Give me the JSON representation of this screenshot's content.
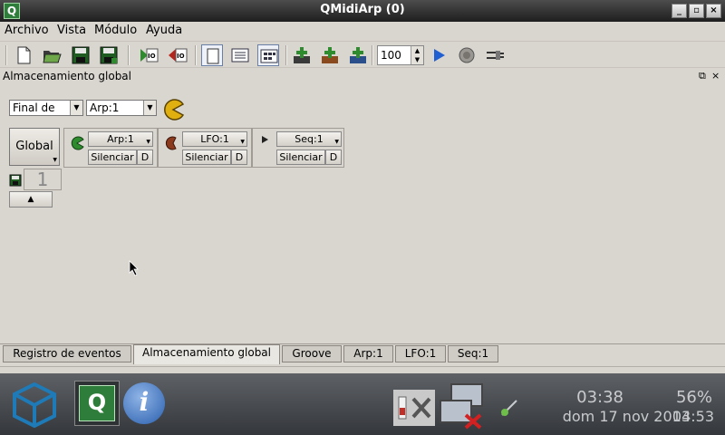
{
  "window": {
    "title": "QMidiArp (0)",
    "app_icon_letter": "Q",
    "minimize_glyph": "_",
    "maximize_glyph": "▫",
    "close_glyph": "×"
  },
  "menu": {
    "items": [
      {
        "label": "Archivo"
      },
      {
        "label": "Vista"
      },
      {
        "label": "Módulo"
      },
      {
        "label": "Ayuda"
      }
    ]
  },
  "toolbar": {
    "tempo_value": "100",
    "icons": [
      "new-file-icon",
      "open-file-icon",
      "save-icon",
      "save-as-icon",
      "midi-in-icon",
      "midi-out-icon",
      "view-page-icon",
      "view-list-icon",
      "view-grid-icon",
      "add-arp-icon",
      "add-lfo-icon",
      "add-seq-icon",
      "play-icon",
      "midi-clock-icon",
      "jack-sync-icon"
    ]
  },
  "dock": {
    "title": "Almacenamiento global",
    "float_glyph": "⧉",
    "close_glyph": "×"
  },
  "global_store": {
    "switch_mode": "Final de",
    "module_select": "Arp:1",
    "global_button": "Global",
    "slot_number": "1",
    "modules": [
      {
        "name": "Arp:1",
        "mute": "Silenciar",
        "delete": "D",
        "color": "#2e8b2e"
      },
      {
        "name": "LFO:1",
        "mute": "Silenciar",
        "delete": "D",
        "color": "#8b3a1e"
      },
      {
        "name": "Seq:1",
        "mute": "Silenciar",
        "delete": "D",
        "color": "#222222"
      }
    ]
  },
  "tabs": [
    {
      "label": "Registro de eventos",
      "active": false
    },
    {
      "label": "Almacenamiento global",
      "active": true
    },
    {
      "label": "Groove",
      "active": false
    },
    {
      "label": "Arp:1",
      "active": false
    },
    {
      "label": "LFO:1",
      "active": false
    },
    {
      "label": "Seq:1",
      "active": false
    }
  ],
  "taskbar": {
    "qmidiarp_letter": "Q",
    "info_letter": "i",
    "time": "03:38",
    "date": "dom 17 nov 2013",
    "battery_percent": "56%",
    "battery_time": "04:53"
  }
}
